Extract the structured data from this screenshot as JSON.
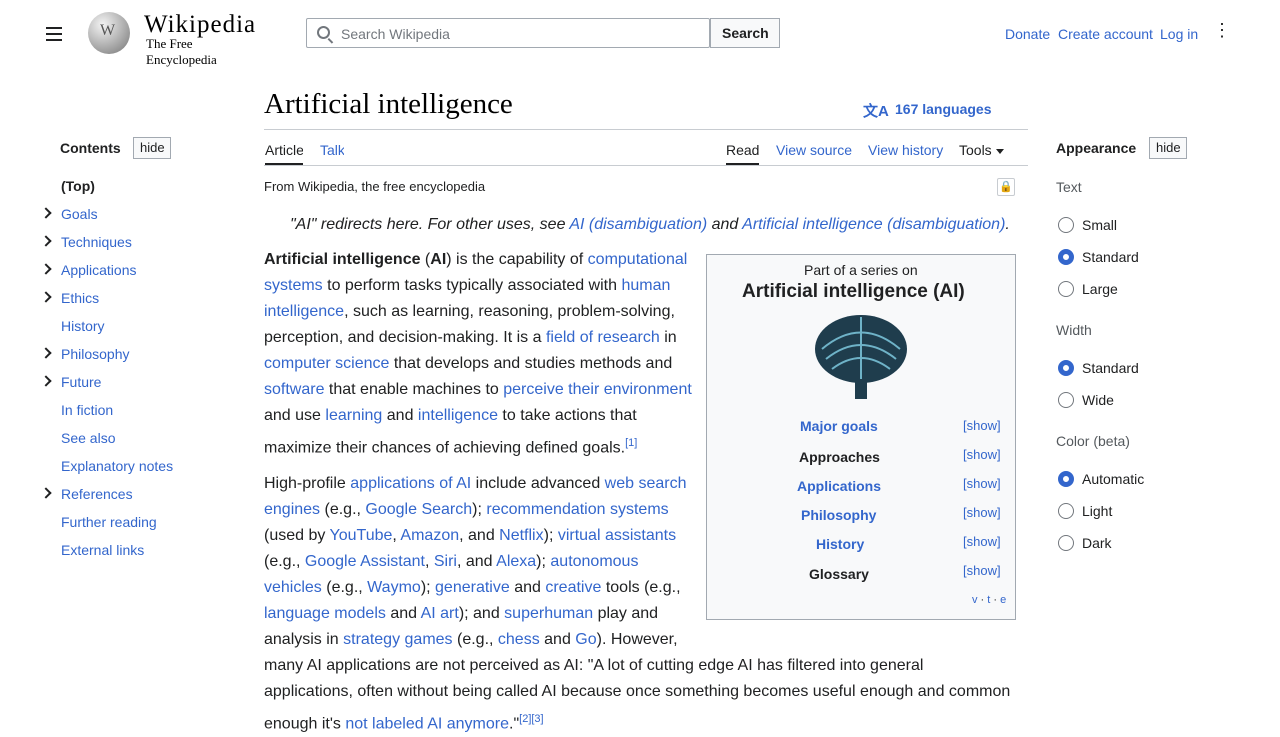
{
  "colors": {
    "link": "#3366cc",
    "text": "#202122",
    "border": "#a2a9b1"
  },
  "header": {
    "logo_word": "Wikipedia",
    "logo_tagline": "The Free Encyclopedia",
    "search_placeholder": "Search Wikipedia",
    "search_button": "Search",
    "donate": "Donate",
    "create_account": "Create account",
    "log_in": "Log in"
  },
  "article": {
    "title": "Artificial intelligence",
    "languages": "167 languages",
    "from": "From Wikipedia, the free encyclopedia",
    "tabs": {
      "article": "Article",
      "talk": "Talk",
      "read": "Read",
      "view_source": "View source",
      "view_history": "View history",
      "tools": "Tools"
    },
    "hatnote": {
      "pre": "\"AI\" redirects here. For other uses, see ",
      "link1": "AI (disambiguation)",
      "mid": " and ",
      "link2": "Artificial intelligence (disambiguation)",
      "post": "."
    },
    "p1": [
      [
        "Artificial intelligence",
        " (",
        "AI",
        ") is the capability of ",
        "computational"
      ],
      [
        "systems",
        " to perform tasks typically associated with ",
        "human"
      ],
      [
        "intelligence",
        ", such as learning, reasoning, problem-solving,"
      ],
      [
        "perception, and decision-making. It is a ",
        "field of research",
        " in"
      ],
      [
        "computer science",
        " that develops and studies methods and"
      ],
      [
        "software",
        " that enable machines to ",
        "perceive their environment"
      ],
      [
        "and use ",
        "learning",
        " and ",
        "intelligence",
        " to take actions that"
      ],
      [
        "maximize their chances of achieving defined goals.",
        "[1]"
      ]
    ],
    "p2": [
      [
        "High-profile ",
        "applications of AI",
        " include advanced ",
        "web search"
      ],
      [
        "engines",
        " (e.g., ",
        "Google Search",
        "); ",
        "recommendation systems"
      ],
      [
        "(used by ",
        "YouTube",
        ", ",
        "Amazon",
        ", and ",
        "Netflix",
        "); ",
        "virtual assistants"
      ],
      [
        "(e.g., ",
        "Google Assistant",
        ", ",
        "Siri",
        ", and ",
        "Alexa",
        "); ",
        "autonomous"
      ],
      [
        "vehicles",
        " (e.g., ",
        "Waymo",
        "); ",
        "generative",
        " and ",
        "creative",
        " tools (e.g.,"
      ],
      [
        "language models",
        " and ",
        "AI art",
        "); and ",
        "superhuman",
        " play and"
      ],
      [
        "analysis in ",
        "strategy games",
        " (e.g., ",
        "chess",
        " and ",
        "Go",
        "). However,"
      ]
    ],
    "p2_wide": [
      "many AI applications are not perceived as AI: \"A lot of cutting edge AI has filtered into general",
      "applications, often without being called AI because once something becomes useful enough and common",
      [
        "enough it's ",
        "not labeled AI anymore",
        ".\"",
        "[2]",
        "[3]"
      ]
    ]
  },
  "toc": {
    "heading": "Contents",
    "hide": "hide",
    "items": [
      "(Top)",
      "Goals",
      "Techniques",
      "Applications",
      "Ethics",
      "History",
      "Philosophy",
      "Future",
      "In fiction",
      "See also",
      "Explanatory notes",
      "References",
      "Further reading",
      "External links"
    ]
  },
  "infobox": {
    "part_of": "Part of a series on",
    "series": "Artificial intelligence (AI)",
    "rows": [
      "Major goals",
      "Approaches",
      "Applications",
      "Philosophy",
      "History",
      "Glossary"
    ],
    "show": "[show]",
    "footer": [
      "v",
      "t",
      "e"
    ]
  },
  "appearance": {
    "heading": "Appearance",
    "hide": "hide",
    "text_label": "Text",
    "text_options": [
      "Small",
      "Standard",
      "Large"
    ],
    "width_label": "Width",
    "width_options": [
      "Standard",
      "Wide"
    ],
    "color_label": "Color (beta)",
    "color_options": [
      "Automatic",
      "Light",
      "Dark"
    ]
  }
}
